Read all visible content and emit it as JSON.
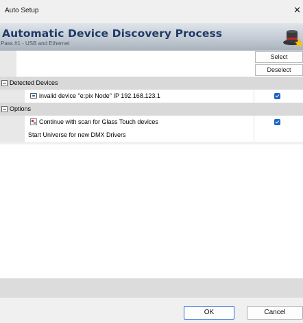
{
  "window": {
    "title": "Auto Setup",
    "close_glyph": "✕"
  },
  "banner": {
    "heading": "Automatic Device Discovery Process",
    "subtitle": "Pass #1 - USB and Ethernet",
    "logo_icon": "magician-hat-icon"
  },
  "toolbar": {
    "select_label": "Select",
    "deselect_label": "Deselect"
  },
  "groups": [
    {
      "label": "Detected Devices",
      "items": [
        {
          "label": "invalid device \"e:pix Node\" IP 192.168.123.1",
          "icon": "network-device-icon",
          "checked": true
        }
      ]
    },
    {
      "label": "Options",
      "items": [
        {
          "label": "Continue with scan for Glass Touch devices",
          "icon": "glass-touch-icon",
          "checked": true
        },
        {
          "label": "Start Universe for new DMX Drivers",
          "icon": "",
          "checked": false
        }
      ]
    }
  ],
  "footer": {
    "ok_label": "OK",
    "cancel_label": "Cancel"
  },
  "colors": {
    "accent": "#1e64c8",
    "heading": "#1f3a66"
  }
}
